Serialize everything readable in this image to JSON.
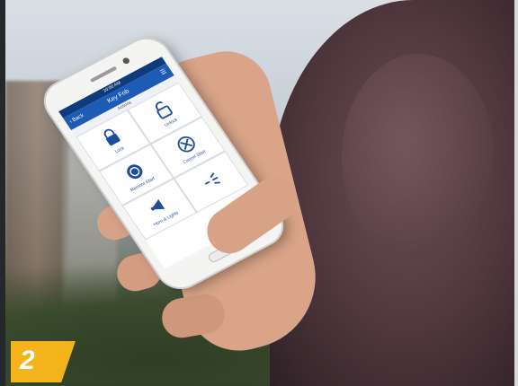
{
  "badge": {
    "number": "2",
    "color": "#f2b31b"
  },
  "app": {
    "status_time": "10:00 AM",
    "title": "Key Fob",
    "back_label": "Back",
    "menu_icon": "menu-icon",
    "section_label": "Actions",
    "accent": "#1e5bb5",
    "buttons": [
      {
        "label": "Lock",
        "icon": "lock-icon"
      },
      {
        "label": "Unlock",
        "icon": "unlock-icon"
      },
      {
        "label": "Remote Start",
        "icon": "remote-start-icon"
      },
      {
        "label": "Cancel Start",
        "icon": "cancel-icon"
      },
      {
        "label": "Horn & Lights",
        "icon": "horn-icon"
      },
      {
        "label": "",
        "icon": "lights-icon"
      }
    ]
  }
}
